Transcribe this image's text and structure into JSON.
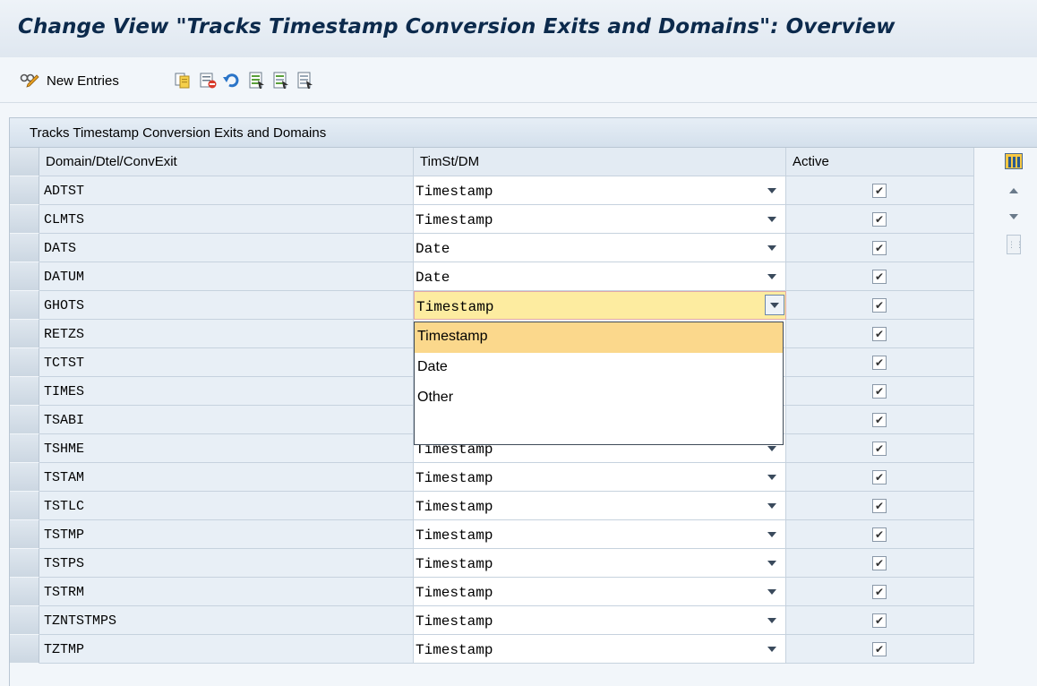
{
  "title": "Change View \"Tracks Timestamp Conversion Exits and Domains\": Overview",
  "toolbar": {
    "new_entries_label": "New Entries",
    "icons": [
      "display-change-icon",
      "copy-icon",
      "delete-icon",
      "undo-icon",
      "select-all-icon",
      "select-block-icon",
      "deselect-all-icon"
    ]
  },
  "table": {
    "title": "Tracks Timestamp Conversion Exits and Domains",
    "headers": [
      "Domain/Dtel/ConvExit",
      "TimSt/DM",
      "Active"
    ],
    "rows": [
      {
        "name": "ADTST",
        "type": "Timestamp",
        "active": true
      },
      {
        "name": "CLMTS",
        "type": "Timestamp",
        "active": true
      },
      {
        "name": "DATS",
        "type": "Date",
        "active": true
      },
      {
        "name": "DATUM",
        "type": "Date",
        "active": true
      },
      {
        "name": "GHOTS",
        "type": "Timestamp",
        "active": true
      },
      {
        "name": "RETZS",
        "type": "",
        "active": true
      },
      {
        "name": "TCTST",
        "type": "",
        "active": true
      },
      {
        "name": "TIMES",
        "type": "",
        "active": true
      },
      {
        "name": "TSABI",
        "type": "",
        "active": true
      },
      {
        "name": "TSHME",
        "type": "Timestamp",
        "active": true
      },
      {
        "name": "TSTAM",
        "type": "Timestamp",
        "active": true
      },
      {
        "name": "TSTLC",
        "type": "Timestamp",
        "active": true
      },
      {
        "name": "TSTMP",
        "type": "Timestamp",
        "active": true
      },
      {
        "name": "TSTPS",
        "type": "Timestamp",
        "active": true
      },
      {
        "name": "TSTRM",
        "type": "Timestamp",
        "active": true
      },
      {
        "name": "TZNTSTMPS",
        "type": "Timestamp",
        "active": true
      },
      {
        "name": "TZTMP",
        "type": "Timestamp",
        "active": true
      }
    ],
    "focused_row": 4
  },
  "dropdown": {
    "options": [
      "Timestamp",
      "Date",
      "Other"
    ],
    "selected": "Timestamp"
  },
  "colors": {
    "title": "#0c2a4c",
    "focus_cell": "#fdeca0",
    "selected_option": "#fbd88c"
  }
}
